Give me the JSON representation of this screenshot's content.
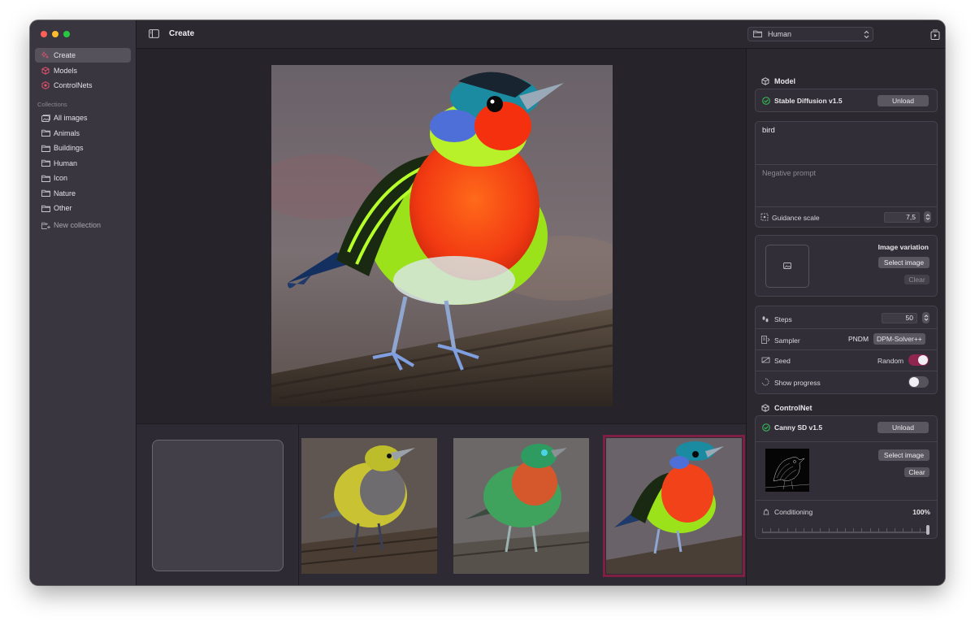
{
  "sidebar": {
    "nav": [
      {
        "label": "Create",
        "icon": "sparkles-icon",
        "active": true
      },
      {
        "label": "Models",
        "icon": "cube-icon"
      },
      {
        "label": "ControlNets",
        "icon": "hexagon-icon"
      }
    ],
    "collections_label": "Collections",
    "collections": [
      {
        "label": "All images",
        "icon": "photo-stack-icon"
      },
      {
        "label": "Animals",
        "icon": "folder-icon"
      },
      {
        "label": "Buildings",
        "icon": "folder-icon"
      },
      {
        "label": "Human",
        "icon": "folder-icon"
      },
      {
        "label": "Icon",
        "icon": "folder-icon"
      },
      {
        "label": "Nature",
        "icon": "folder-icon"
      },
      {
        "label": "Other",
        "icon": "folder-icon"
      }
    ],
    "new_collection": "New collection"
  },
  "header": {
    "title": "Create",
    "collection_select": "Human"
  },
  "panel": {
    "model_heading": "Model",
    "model_name": "Stable Diffusion v1.5",
    "unload_label": "Unload",
    "prompt": "bird",
    "negative_placeholder": "Negative prompt",
    "guidance_label": "Guidance scale",
    "guidance_value": "7,5",
    "variation_label": "Image variation",
    "select_image_label": "Select image",
    "clear_label": "Clear",
    "steps_label": "Steps",
    "steps_value": "50",
    "sampler_label": "Sampler",
    "sampler_options": [
      "PNDM",
      "DPM-Solver++"
    ],
    "sampler_selected": "DPM-Solver++",
    "seed_label": "Seed",
    "seed_mode": "Random",
    "seed_random_on": true,
    "progress_label": "Show progress",
    "progress_on": false,
    "controlnet_heading": "ControlNet",
    "controlnet_name": "Canny SD v1.5",
    "conditioning_label": "Conditioning",
    "conditioning_value": "100%",
    "conditioning_fraction": 1.0
  },
  "colors": {
    "accent": "#8e2650",
    "selected_border": "#7f1f43",
    "loaded_green": "#34c759"
  }
}
